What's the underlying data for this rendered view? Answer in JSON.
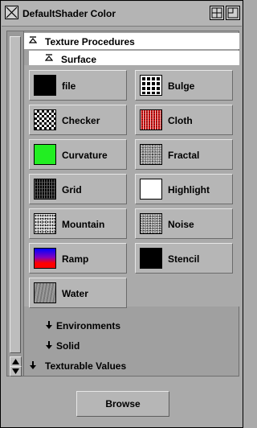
{
  "window": {
    "title": "DefaultShader Color"
  },
  "sections": {
    "texture_procedures": "Texture Procedures",
    "surface": "Surface",
    "environments": "Environments",
    "solid": "Solid",
    "texturable_values": "Texturable Values"
  },
  "tiles": [
    {
      "label": "file",
      "icon": "file-swatch"
    },
    {
      "label": "Bulge",
      "icon": "bulge-swatch"
    },
    {
      "label": "Checker",
      "icon": "checker-swatch"
    },
    {
      "label": "Cloth",
      "icon": "cloth-swatch"
    },
    {
      "label": "Curvature",
      "icon": "curvature-swatch"
    },
    {
      "label": "Fractal",
      "icon": "fractal-swatch"
    },
    {
      "label": "Grid",
      "icon": "grid-swatch"
    },
    {
      "label": "Highlight",
      "icon": "highlight-swatch"
    },
    {
      "label": "Mountain",
      "icon": "mountain-swatch"
    },
    {
      "label": "Noise",
      "icon": "noise-swatch"
    },
    {
      "label": "Ramp",
      "icon": "ramp-swatch"
    },
    {
      "label": "Stencil",
      "icon": "stencil-swatch"
    },
    {
      "label": "Water",
      "icon": "water-swatch"
    }
  ],
  "footer": {
    "browse_label": "Browse"
  },
  "colors": {
    "panel_bg": "#aaaaaa",
    "curvature": "#22ee22",
    "cloth": "#cc1111"
  }
}
